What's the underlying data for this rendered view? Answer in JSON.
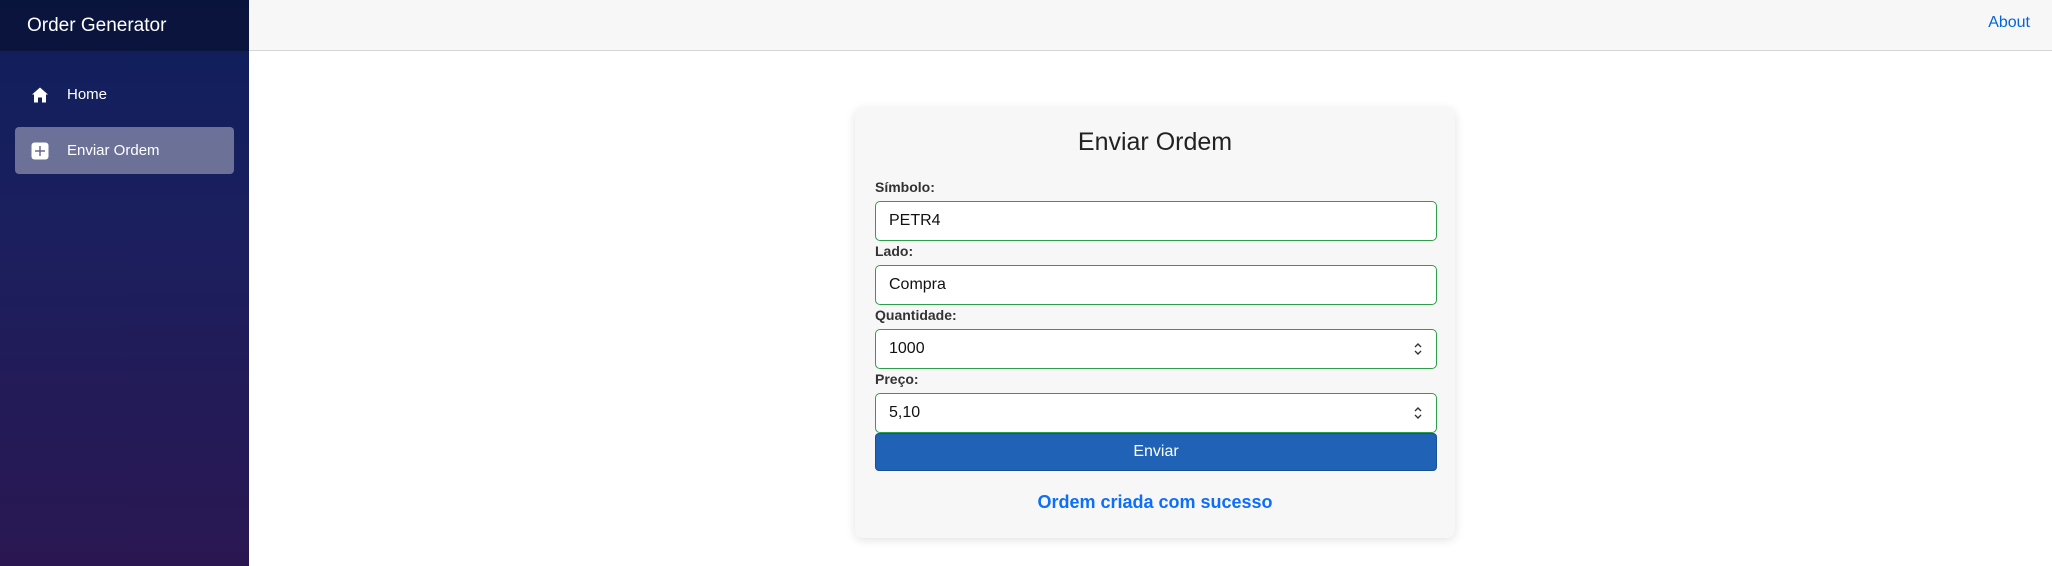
{
  "app": {
    "brand": "Order Generator"
  },
  "sidebar": {
    "items": [
      {
        "label": "Home",
        "icon": "home-icon",
        "active": false
      },
      {
        "label": "Enviar Ordem",
        "icon": "plus-square-icon",
        "active": true
      }
    ]
  },
  "topbar": {
    "about_label": "About"
  },
  "form": {
    "title": "Enviar Ordem",
    "fields": [
      {
        "label": "Símbolo:",
        "value": "PETR4"
      },
      {
        "label": "Lado:",
        "value": "Compra"
      },
      {
        "label": "Quantidade:",
        "value": "1000"
      },
      {
        "label": "Preço:",
        "value": "5,10"
      }
    ],
    "submit_label": "Enviar",
    "status_message": "Ordem criada com sucesso"
  },
  "colors": {
    "sidebar_top": "#0f1f5c",
    "sidebar_bottom": "#2a1752",
    "accent_button": "#2063b6",
    "field_border": "#2e9e4a",
    "success_text": "#0d6efd",
    "link": "#0366d6"
  }
}
